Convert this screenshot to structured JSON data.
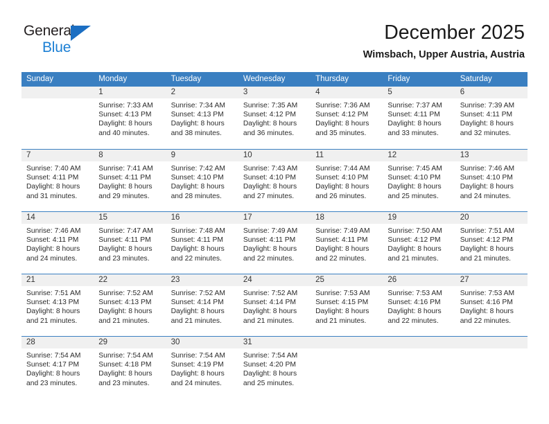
{
  "logo": {
    "text_top": "General",
    "text_bottom": "Blue",
    "triangle_icon": "triangle-icon",
    "color_blue": "#1b7fd4",
    "color_triangle": "#1b6ec2",
    "color_dark": "#231f20"
  },
  "header": {
    "title": "December 2025",
    "subtitle": "Wimsbach, Upper Austria, Austria"
  },
  "theme": {
    "header_bg": "#3a7fc1",
    "day_band_bg": "#f0f0f0"
  },
  "weekdays": [
    "Sunday",
    "Monday",
    "Tuesday",
    "Wednesday",
    "Thursday",
    "Friday",
    "Saturday"
  ],
  "weeks": [
    [
      {
        "day": "",
        "lines": []
      },
      {
        "day": "1",
        "lines": [
          "Sunrise: 7:33 AM",
          "Sunset: 4:13 PM",
          "Daylight: 8 hours",
          "and 40 minutes."
        ]
      },
      {
        "day": "2",
        "lines": [
          "Sunrise: 7:34 AM",
          "Sunset: 4:13 PM",
          "Daylight: 8 hours",
          "and 38 minutes."
        ]
      },
      {
        "day": "3",
        "lines": [
          "Sunrise: 7:35 AM",
          "Sunset: 4:12 PM",
          "Daylight: 8 hours",
          "and 36 minutes."
        ]
      },
      {
        "day": "4",
        "lines": [
          "Sunrise: 7:36 AM",
          "Sunset: 4:12 PM",
          "Daylight: 8 hours",
          "and 35 minutes."
        ]
      },
      {
        "day": "5",
        "lines": [
          "Sunrise: 7:37 AM",
          "Sunset: 4:11 PM",
          "Daylight: 8 hours",
          "and 33 minutes."
        ]
      },
      {
        "day": "6",
        "lines": [
          "Sunrise: 7:39 AM",
          "Sunset: 4:11 PM",
          "Daylight: 8 hours",
          "and 32 minutes."
        ]
      }
    ],
    [
      {
        "day": "7",
        "lines": [
          "Sunrise: 7:40 AM",
          "Sunset: 4:11 PM",
          "Daylight: 8 hours",
          "and 31 minutes."
        ]
      },
      {
        "day": "8",
        "lines": [
          "Sunrise: 7:41 AM",
          "Sunset: 4:11 PM",
          "Daylight: 8 hours",
          "and 29 minutes."
        ]
      },
      {
        "day": "9",
        "lines": [
          "Sunrise: 7:42 AM",
          "Sunset: 4:10 PM",
          "Daylight: 8 hours",
          "and 28 minutes."
        ]
      },
      {
        "day": "10",
        "lines": [
          "Sunrise: 7:43 AM",
          "Sunset: 4:10 PM",
          "Daylight: 8 hours",
          "and 27 minutes."
        ]
      },
      {
        "day": "11",
        "lines": [
          "Sunrise: 7:44 AM",
          "Sunset: 4:10 PM",
          "Daylight: 8 hours",
          "and 26 minutes."
        ]
      },
      {
        "day": "12",
        "lines": [
          "Sunrise: 7:45 AM",
          "Sunset: 4:10 PM",
          "Daylight: 8 hours",
          "and 25 minutes."
        ]
      },
      {
        "day": "13",
        "lines": [
          "Sunrise: 7:46 AM",
          "Sunset: 4:10 PM",
          "Daylight: 8 hours",
          "and 24 minutes."
        ]
      }
    ],
    [
      {
        "day": "14",
        "lines": [
          "Sunrise: 7:46 AM",
          "Sunset: 4:11 PM",
          "Daylight: 8 hours",
          "and 24 minutes."
        ]
      },
      {
        "day": "15",
        "lines": [
          "Sunrise: 7:47 AM",
          "Sunset: 4:11 PM",
          "Daylight: 8 hours",
          "and 23 minutes."
        ]
      },
      {
        "day": "16",
        "lines": [
          "Sunrise: 7:48 AM",
          "Sunset: 4:11 PM",
          "Daylight: 8 hours",
          "and 22 minutes."
        ]
      },
      {
        "day": "17",
        "lines": [
          "Sunrise: 7:49 AM",
          "Sunset: 4:11 PM",
          "Daylight: 8 hours",
          "and 22 minutes."
        ]
      },
      {
        "day": "18",
        "lines": [
          "Sunrise: 7:49 AM",
          "Sunset: 4:11 PM",
          "Daylight: 8 hours",
          "and 22 minutes."
        ]
      },
      {
        "day": "19",
        "lines": [
          "Sunrise: 7:50 AM",
          "Sunset: 4:12 PM",
          "Daylight: 8 hours",
          "and 21 minutes."
        ]
      },
      {
        "day": "20",
        "lines": [
          "Sunrise: 7:51 AM",
          "Sunset: 4:12 PM",
          "Daylight: 8 hours",
          "and 21 minutes."
        ]
      }
    ],
    [
      {
        "day": "21",
        "lines": [
          "Sunrise: 7:51 AM",
          "Sunset: 4:13 PM",
          "Daylight: 8 hours",
          "and 21 minutes."
        ]
      },
      {
        "day": "22",
        "lines": [
          "Sunrise: 7:52 AM",
          "Sunset: 4:13 PM",
          "Daylight: 8 hours",
          "and 21 minutes."
        ]
      },
      {
        "day": "23",
        "lines": [
          "Sunrise: 7:52 AM",
          "Sunset: 4:14 PM",
          "Daylight: 8 hours",
          "and 21 minutes."
        ]
      },
      {
        "day": "24",
        "lines": [
          "Sunrise: 7:52 AM",
          "Sunset: 4:14 PM",
          "Daylight: 8 hours",
          "and 21 minutes."
        ]
      },
      {
        "day": "25",
        "lines": [
          "Sunrise: 7:53 AM",
          "Sunset: 4:15 PM",
          "Daylight: 8 hours",
          "and 21 minutes."
        ]
      },
      {
        "day": "26",
        "lines": [
          "Sunrise: 7:53 AM",
          "Sunset: 4:16 PM",
          "Daylight: 8 hours",
          "and 22 minutes."
        ]
      },
      {
        "day": "27",
        "lines": [
          "Sunrise: 7:53 AM",
          "Sunset: 4:16 PM",
          "Daylight: 8 hours",
          "and 22 minutes."
        ]
      }
    ],
    [
      {
        "day": "28",
        "lines": [
          "Sunrise: 7:54 AM",
          "Sunset: 4:17 PM",
          "Daylight: 8 hours",
          "and 23 minutes."
        ]
      },
      {
        "day": "29",
        "lines": [
          "Sunrise: 7:54 AM",
          "Sunset: 4:18 PM",
          "Daylight: 8 hours",
          "and 23 minutes."
        ]
      },
      {
        "day": "30",
        "lines": [
          "Sunrise: 7:54 AM",
          "Sunset: 4:19 PM",
          "Daylight: 8 hours",
          "and 24 minutes."
        ]
      },
      {
        "day": "31",
        "lines": [
          "Sunrise: 7:54 AM",
          "Sunset: 4:20 PM",
          "Daylight: 8 hours",
          "and 25 minutes."
        ]
      },
      {
        "day": "",
        "lines": []
      },
      {
        "day": "",
        "lines": []
      },
      {
        "day": "",
        "lines": []
      }
    ]
  ]
}
